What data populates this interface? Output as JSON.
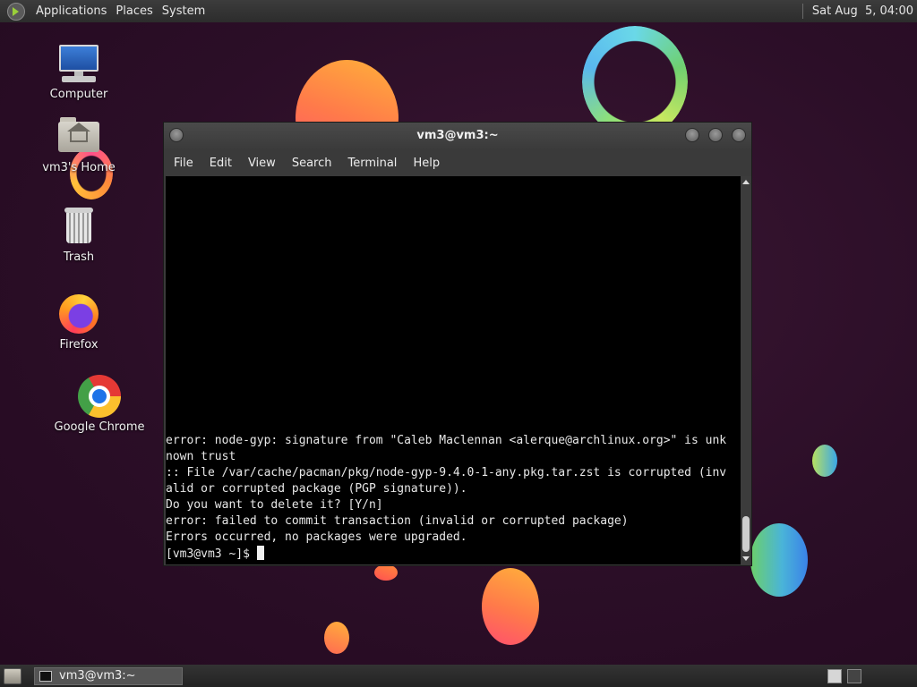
{
  "top_panel": {
    "menus": [
      "Applications",
      "Places",
      "System"
    ],
    "clock": "Sat Aug  5, 04:00"
  },
  "desktop_icons": [
    {
      "label": "Computer",
      "icon": "computer-icon"
    },
    {
      "label": "vm3's Home",
      "icon": "home-folder-icon"
    },
    {
      "label": "Trash",
      "icon": "trash-icon"
    },
    {
      "label": "Firefox",
      "icon": "firefox-icon"
    },
    {
      "label": "Google Chrome",
      "icon": "chrome-icon"
    }
  ],
  "terminal": {
    "title": "vm3@vm3:~",
    "menu": [
      "File",
      "Edit",
      "View",
      "Search",
      "Terminal",
      "Help"
    ],
    "output": "error: node-gyp: signature from \"Caleb Maclennan <alerque@archlinux.org>\" is unk\nnown trust\n:: File /var/cache/pacman/pkg/node-gyp-9.4.0-1-any.pkg.tar.zst is corrupted (inv\nalid or corrupted package (PGP signature)).\nDo you want to delete it? [Y/n]\nerror: failed to commit transaction (invalid or corrupted package)\nErrors occurred, no packages were upgraded.",
    "prompt": "[vm3@vm3 ~]$ "
  },
  "taskbar": {
    "tasks": [
      {
        "label": "vm3@vm3:~"
      }
    ]
  }
}
